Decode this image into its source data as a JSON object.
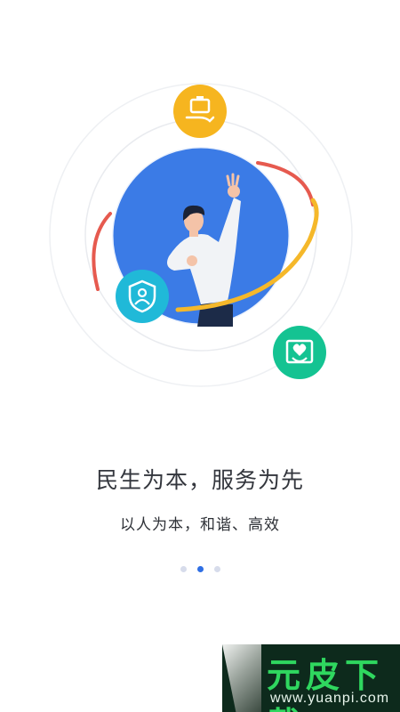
{
  "onboarding": {
    "title": "民生为本，服务为先",
    "subtitle": "以人为本，和谐、高效",
    "pages": 3,
    "active_page": 2,
    "icons": [
      "service-hand-icon",
      "shield-user-icon",
      "heart-care-icon"
    ]
  },
  "watermark": {
    "title": "元皮下载",
    "url": "www.yuanpi.com"
  },
  "colors": {
    "main_circle_blue": "#3b7be6",
    "orbit_red": "#e65a4f",
    "orbit_yellow": "#f5b82a",
    "icon_yellow": "#f6b51f",
    "icon_cyan": "#20b9d8",
    "icon_green": "#14c392",
    "dot_active": "#2f6fe4",
    "dot_inactive": "#d7dceb",
    "watermark_green": "#2fd75f"
  }
}
